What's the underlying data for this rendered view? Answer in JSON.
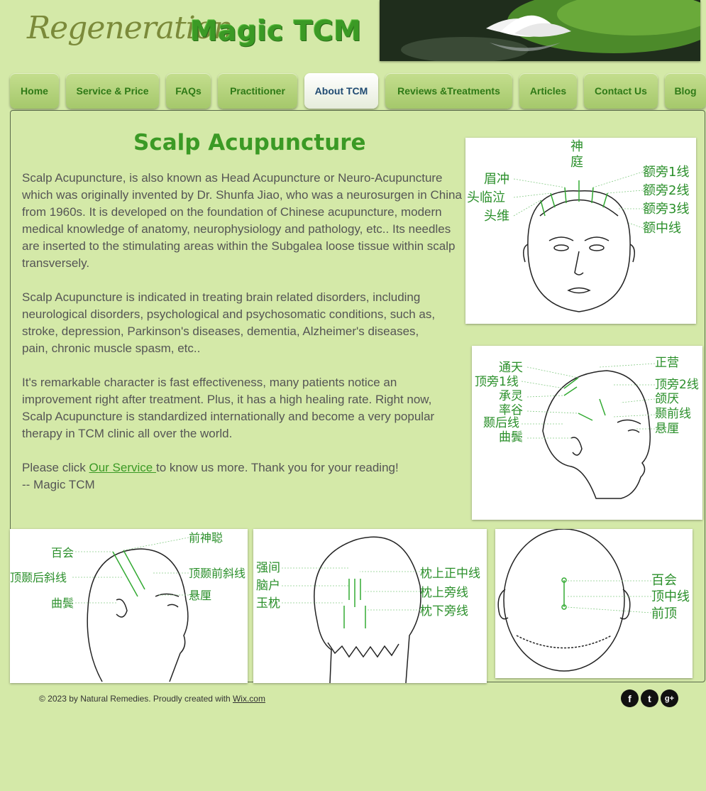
{
  "header": {
    "brand_script": "Regeneration",
    "site_title": "Magic TCM"
  },
  "nav": {
    "items": [
      {
        "label": "Home"
      },
      {
        "label": "Service & Price"
      },
      {
        "label": "FAQs"
      },
      {
        "label": "Practitioner"
      },
      {
        "label": "About TCM",
        "active": true
      },
      {
        "label": "Reviews &Treatments"
      },
      {
        "label": "Articles"
      },
      {
        "label": "Contact Us"
      },
      {
        "label": "Blog"
      }
    ]
  },
  "main": {
    "heading": "Scalp Acupuncture",
    "para1": "Scalp Acupuncture, is also known as Head Acupuncture or Neuro-Acupuncture which was originally invented by Dr. Shunfa Jiao, who was a neurosurgen in China from 1960s. It is developed on the foundation of Chinese acupuncture, modern medical knowledge of anatomy, neurophysiology and pathology, etc.. Its needles are inserted to the stimulating areas within the Subgalea loose tissue within scalp transversely.",
    "para2": "Scalp Acupuncture is indicated in treating brain related disorders, including neurological disorders, psychological and psychosomatic conditions, such as, stroke, depression, Parkinson's diseases, dementia, Alzheimer's diseases, pain, chronic muscle spasm, etc..",
    "para3": "It's remarkable character is fast effectiveness, many patients notice an improvement  right after treatment. Plus, it has a high healing rate. Right now, Scalp Acupuncture is  standardized internationally and become a very popular therapy in TCM clinic all over the world.",
    "para4_before": " Please click ",
    "para4_link": "Our Service ",
    "para4_after": "to know us more. Thank you for your reading!",
    "signature": "-- Magic TCM"
  },
  "figures": {
    "front": {
      "left": [
        "眉冲",
        "头临泣",
        "头维"
      ],
      "top": [
        "神",
        "庭"
      ],
      "right": [
        "额旁1线",
        "额旁2线",
        "额旁3线",
        "额中线"
      ]
    },
    "side_right": {
      "left": [
        "通天",
        "顶旁1线",
        "承灵",
        "率谷",
        "颞后线",
        "曲鬓"
      ],
      "right": [
        "正营",
        "顶旁2线",
        "颌厌",
        "颞前线",
        "悬厘"
      ]
    },
    "side_left": {
      "left": [
        "百会",
        "顶颞后斜线",
        "曲鬓"
      ],
      "right": [
        "前神聪",
        "顶颞前斜线",
        "悬厘"
      ]
    },
    "back": {
      "left": [
        "强间",
        "脑户",
        "玉枕"
      ],
      "right": [
        "枕上正中线",
        "枕上旁线",
        "枕下旁线"
      ]
    },
    "top": {
      "right": [
        "百会",
        "顶中线",
        "前顶"
      ]
    }
  },
  "footer": {
    "copyright_text": "© 2023 by Natural Remedies. Proudly created with ",
    "copyright_link": "Wix.com",
    "social": [
      {
        "icon": "facebook-icon",
        "glyph": "f"
      },
      {
        "icon": "twitter-icon",
        "glyph": "t"
      },
      {
        "icon": "google-plus-icon",
        "glyph": "g+"
      }
    ]
  },
  "colors": {
    "page_bg": "#d4e9a8",
    "brand_green": "#3b9a25",
    "nav_active_text": "#1f4a72",
    "label_green": "#2a8f2a"
  }
}
